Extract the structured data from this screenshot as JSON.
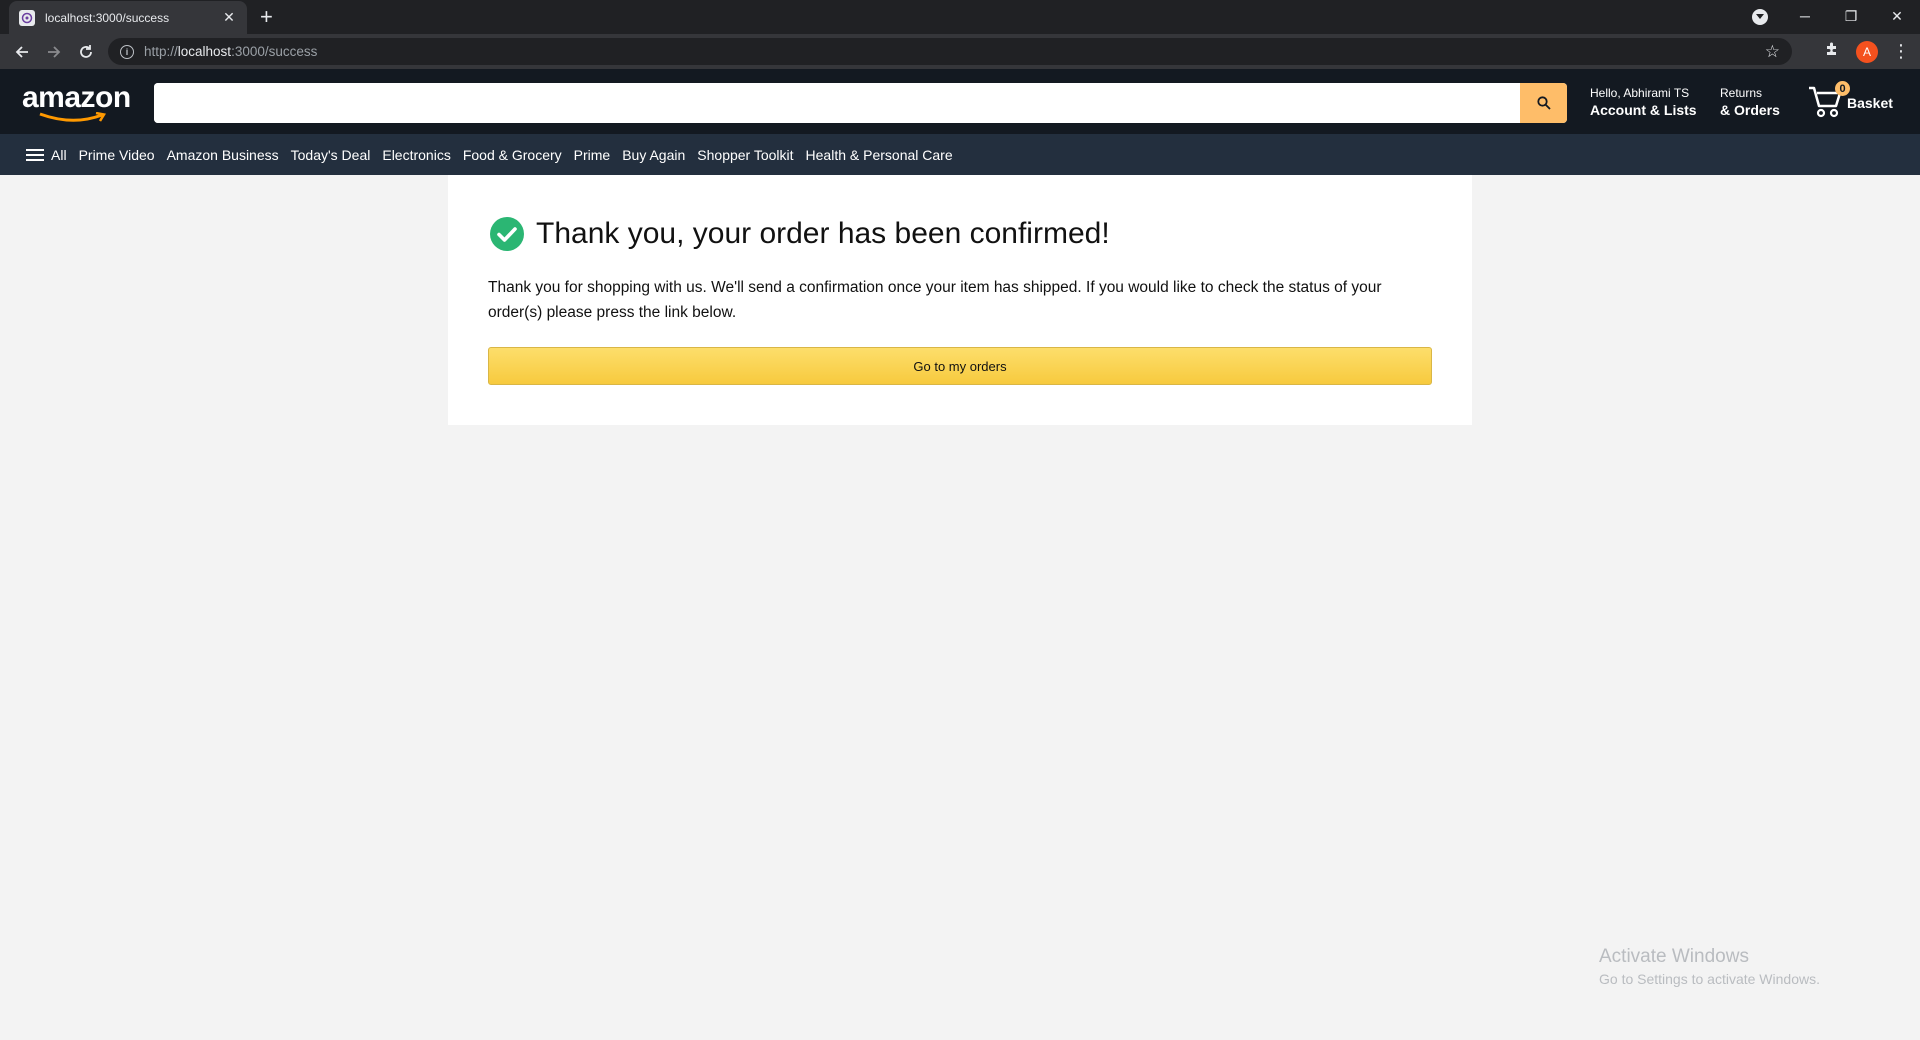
{
  "browser": {
    "tab_title": "localhost:3000/success",
    "tab_close": "✕",
    "new_tab": "+",
    "url_prefix": "http://",
    "url_host": "localhost",
    "url_rest": ":3000/success",
    "profile_initial": "A",
    "window": {
      "minimize": "─",
      "restore": "❐",
      "close": "✕"
    }
  },
  "header": {
    "logo": "amazon",
    "search": {
      "value": "",
      "placeholder": ""
    },
    "account": {
      "line1": "Hello, Abhirami TS",
      "line2": "Account & Lists"
    },
    "orders": {
      "line1": "Returns",
      "line2": "& Orders"
    },
    "basket": {
      "count": "0",
      "label": "Basket"
    }
  },
  "subnav": {
    "all": "All",
    "items": [
      "Prime Video",
      "Amazon Business",
      "Today's Deal",
      "Electronics",
      "Food & Grocery",
      "Prime",
      "Buy Again",
      "Shopper Toolkit",
      "Health & Personal Care"
    ]
  },
  "success": {
    "title": "Thank you, your order has been confirmed!",
    "message": "Thank you for shopping with us. We'll send a confirmation once your item has shipped. If you would like to check the status of your order(s) please press the link below.",
    "button": "Go to my orders"
  },
  "watermark": {
    "line1": "Activate Windows",
    "line2": "Go to Settings to activate Windows."
  },
  "colors": {
    "header_bg": "#131921",
    "subnav_bg": "#232f3e",
    "search_button": "#febd69",
    "check_green": "#2bb673",
    "button_yellow": "#f7ca3e"
  }
}
